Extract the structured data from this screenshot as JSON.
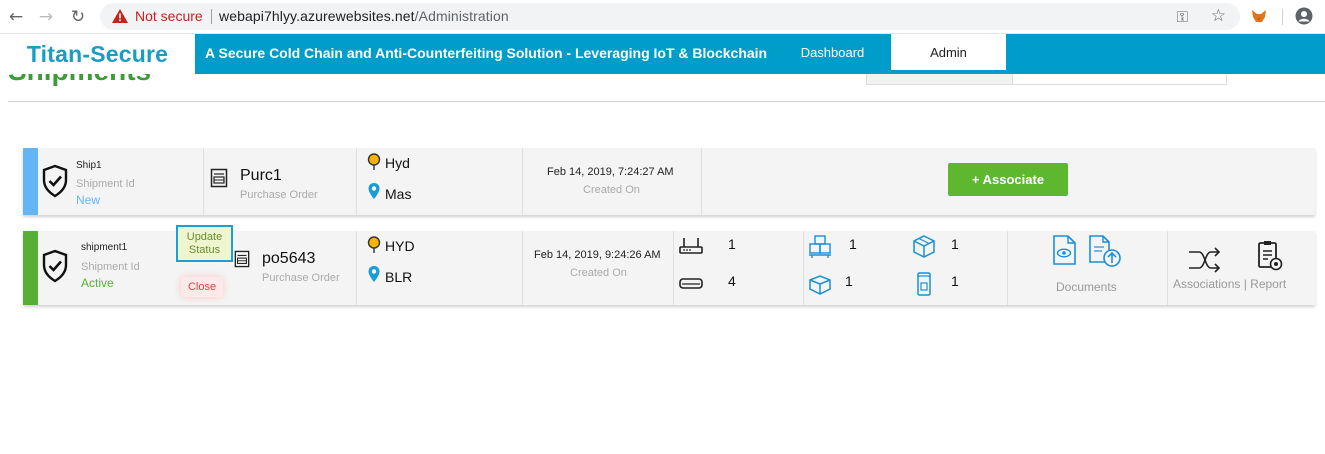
{
  "browser": {
    "security_label": "Not secure",
    "url_host": "webapi7hlyy.azurewebsites.net",
    "url_path": "/Administration"
  },
  "app": {
    "brand": "Titan-Secure",
    "tagline": "A Secure Cold Chain and Anti-Counterfeiting Solution - Leveraging IoT & Blockchain",
    "tabs": [
      {
        "label": "Dashboard",
        "active": false
      },
      {
        "label": "Admin",
        "active": true
      }
    ],
    "page_title": "Shipments"
  },
  "shipments": [
    {
      "name": "Ship1",
      "id_label": "Shipment Id",
      "status": "New",
      "po": "Purc1",
      "po_label": "Purchase Order",
      "from": "Hyd",
      "to": "Mas",
      "date": "Feb 14, 2019, 7:24:27 AM",
      "date_label": "Created On",
      "associate_label": "+ Associate",
      "stripe_color": "#63b5f6"
    },
    {
      "name": "shipment1",
      "id_label": "Shipment Id",
      "status": "Active",
      "update_label_1": "Update",
      "update_label_2": "Status",
      "close_label": "Close",
      "po": "po5643",
      "po_label": "Purchase Order",
      "from": "HYD",
      "to": "BLR",
      "date": "Feb 14, 2019, 9:24:26 AM",
      "date_label": "Created On",
      "devices": [
        {
          "icon": "gateway-router-icon",
          "count": "1"
        },
        {
          "icon": "sensor-box-icon",
          "count": "4"
        },
        {
          "icon": "pallet-boxes-icon",
          "count": "1"
        },
        {
          "icon": "package-open-icon",
          "count": "1"
        },
        {
          "icon": "cube-box-icon",
          "count": "1"
        },
        {
          "icon": "mobile-tag-icon",
          "count": "1"
        }
      ],
      "documents_label": "Documents",
      "associations_label": "Associations | Report",
      "stripe_color": "#55b035"
    }
  ]
}
